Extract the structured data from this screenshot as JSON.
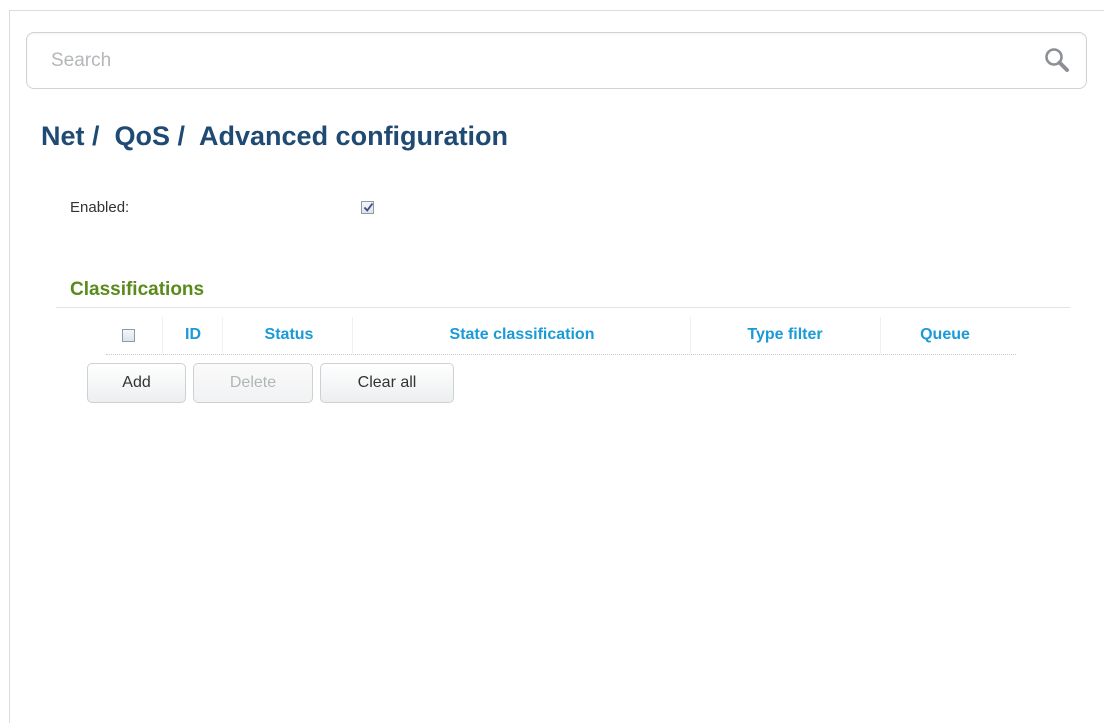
{
  "search": {
    "placeholder": "Search",
    "value": "",
    "icon": "search-icon"
  },
  "breadcrumb": {
    "text": "Net /  QoS /  Advanced configuration"
  },
  "enabled": {
    "label": "Enabled:",
    "checked": true
  },
  "classifications": {
    "title": "Classifications",
    "columns": [
      "ID",
      "Status",
      "State classification",
      "Type filter",
      "Queue"
    ],
    "rows": []
  },
  "buttons": {
    "add": "Add",
    "delete": "Delete",
    "delete_disabled": true,
    "clear_all": "Clear all"
  },
  "colors": {
    "title": "#1f4a73",
    "section": "#5a8a1c",
    "column_header": "#1a9ad7"
  }
}
